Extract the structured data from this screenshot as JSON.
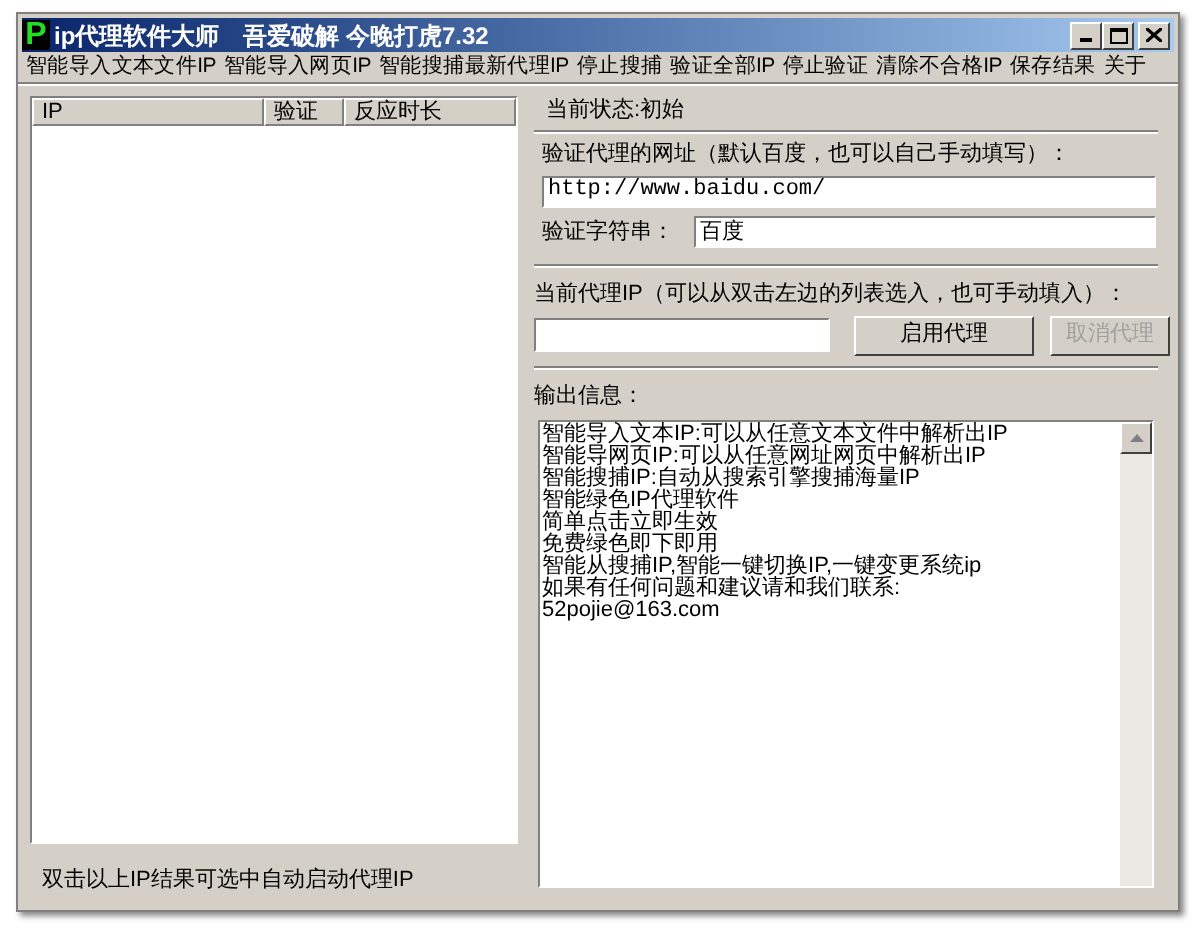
{
  "window": {
    "title_letter": "P",
    "title": "ip代理软件大师　吾爱破解 今晚打虎7.32"
  },
  "menu": [
    "智能导入文本文件IP",
    "智能导入网页IP",
    "智能搜捕最新代理IP",
    "停止搜捕",
    "验证全部IP",
    "停止验证",
    "清除不合格IP",
    "保存结果",
    "关于"
  ],
  "table": {
    "columns": [
      "IP",
      "验证",
      "反应时长"
    ]
  },
  "status": "当前状态:初始",
  "verify_url": {
    "label": "验证代理的网址（默认百度，也可以自己手动填写）：",
    "value": "http://www.baidu.com/"
  },
  "verify_string": {
    "label": "验证字符串：",
    "value": "百度"
  },
  "proxy": {
    "label": "当前代理IP（可以从双击左边的列表选入，也可手动填入）："
  },
  "buttons": [
    {
      "label": "启用代理",
      "disabled": false
    },
    {
      "label": "取消代理",
      "disabled": true
    }
  ],
  "output": {
    "label": "输出信息：",
    "lines": [
      "智能导入文本IP:可以从任意文本文件中解析出IP",
      "智能导网页IP:可以从任意网址网页中解析出IP",
      "智能搜捕IP:自动从搜索引擎搜捕海量IP",
      "智能绿色IP代理软件",
      "简单点击立即生效",
      "免费绿色即下即用",
      "智能从搜捕IP,智能一键切换IP,一键变更系统ip",
      "如果有任何问题和建议请和我们联系:",
      "52pojie@163.com"
    ]
  },
  "hint": "双击以上IP结果可选中自动启动代理IP"
}
